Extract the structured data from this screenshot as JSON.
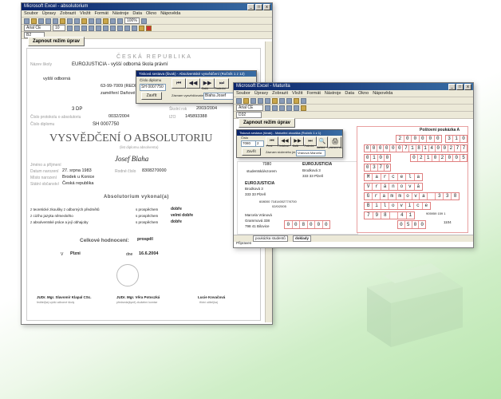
{
  "word": {
    "title": "Microsoft Excel - absolutorium",
    "menu": [
      "Soubor",
      "Úpravy",
      "Zobrazit",
      "Vložit",
      "Formát",
      "Nástroje",
      "Data",
      "Okno",
      "Nápověda"
    ],
    "font_name": "Arial CE",
    "font_size": "10",
    "zoom": "100%",
    "cell_ref": "B2",
    "protect_button": "Zapnout režim úprav"
  },
  "certificate": {
    "country": "ČESKÁ REPUBLIKA",
    "school_label": "Název školy",
    "school_name": "EUROJUSTICIA - vyšší odborná škola právní",
    "school_type": "vyšší odborná",
    "school_addr": "63-99-7009 (REDIZOV)",
    "school_kind": "zaměření  Daňové poradenství",
    "reg_no_label": "Evidenční číslo",
    "reg_no": "3 DP",
    "date_label": "Školní rok",
    "date_val": "2003/2004",
    "izo_label": "IZO",
    "izo": "145893388",
    "copy_label": "Číslo protokolu o absolutoriu",
    "copy_val": "0032/2004",
    "diploma_label": "Číslo diplomu",
    "diploma_no": "SH 0007750",
    "heading": "VYSVĚDČENÍ O ABSOLUTORIU",
    "subheading": "(list diplomu absolventa)",
    "name": "Josef  Blaha",
    "name_label": "Jméno a příjmení",
    "birth_label": "Datum narození",
    "birth": "27. srpna 1983",
    "rc_label": "Rodné číslo",
    "rc": "8308270000",
    "birthplace_label": "Místo narození",
    "birthplace": "Brodek u Konice",
    "citizenship_label": "Státní občanství",
    "citizenship": "Česká republika",
    "exam_title": "Absolutorium vykonal(a)",
    "exam_rows": [
      {
        "subject": "z teoretické zkoušky z odborných předmětů",
        "result": "s prospěchem",
        "grade": "dobře"
      },
      {
        "subject": "z cizího jazyka  německého",
        "result": "s prospěchem",
        "grade": "velmi dobře"
      },
      {
        "subject": "z absolventské práce a její obhajoby",
        "result": "s prospěchem",
        "grade": "dobře"
      }
    ],
    "overall_label": "Celkové hodnocení:",
    "overall": "prospěl",
    "place_label": "V",
    "place": "Plzni",
    "day_label": "dne",
    "day": "16.6.2004",
    "sig1_name": "JUDr. Mgr. Slavomír Klapal CSc.",
    "sig1_role": "ředitel(ka) vyšší odborné školy",
    "sig2_name": "JUDr. Mgr. Věra Potoczká",
    "sig2_role": "předseda(kyně) zkušební komise",
    "sig3_name": "Lucie Kovačová",
    "sig3_role": "třídní učitel(ka)"
  },
  "word_dialog": {
    "title": "Tisková sestava (šivak) - Absolventské vysvědčení (Ročník 1 z 12)",
    "field_label": "Číslo diplomu",
    "field_value": "SH 0007750",
    "print_label": "Záznam vysvědčovatelem",
    "print_value": "Blaha Josef",
    "btn_first": "První",
    "btn_prev": "Předchozí",
    "btn_next": "Další",
    "btn_last": "Poslední",
    "btn_print": "Zavřít"
  },
  "excel": {
    "title": "Microsoft Excel - Maturita",
    "menu": [
      "Soubor",
      "Úpravy",
      "Zobrazit",
      "Vložit",
      "Formát",
      "Nástroje",
      "Data",
      "Okno",
      "Nápověda"
    ],
    "font_name": "Arial CE",
    "cell_ref": "D32",
    "protect_button": "Zapnout režim úprav",
    "dialog_title": "Tisková sestava (šivak) - Maturitní zkouška (Ročník 1 z 1)",
    "dlg_field_label": "Číslo",
    "dlg_field_value": "7080",
    "dlg_field2_value": "2",
    "dlg_btn_close": "Zavřít",
    "dlg_sel_label": "Záznam složeného jm.",
    "dlg_sel_value": "Vránová Marcela",
    "dlg_btns": [
      "První",
      "Předchozí",
      "Další",
      "Poslední"
    ],
    "dlg_btn_print": "Nahled",
    "dlg_btn_print2": "Vytisknout vše",
    "cells": {
      "c1": "7080",
      "c2": "EUROJUSTICIA",
      "c3": "studentská/vzorem",
      "c4": "Brodková 3",
      "c5": "333 33 Plzeň",
      "c6": "EUROJUSTICIA",
      "c7": "Brodková 3",
      "c8": "333 33 Plzeň",
      "c9": "608000 7181400277/0700",
      "c10": "02/0/2005",
      "c11": "Marcela Vránová",
      "c12": "Grammová 338",
      "c13": "798 41 Bilovice"
    },
    "poukaz_title": "Poštovní poukázka A",
    "boxes": {
      "r1": [
        "2",
        "0",
        "0",
        "0",
        "0",
        "0"
      ],
      "r1b": [
        "3",
        "1",
        "0"
      ],
      "r2": [
        "0",
        "0",
        "0",
        "0",
        "0",
        "0",
        "7",
        "1",
        "8",
        "1",
        "4",
        "0",
        "0",
        "2",
        "7",
        "7"
      ],
      "r3": [
        "0",
        "1",
        "0",
        "0"
      ],
      "r3b": [
        "0",
        "2",
        "1",
        "0",
        "2",
        "0",
        "0",
        "5"
      ],
      "r4": [
        "0",
        "3",
        "7",
        "9"
      ],
      "name": [
        "M",
        "a",
        "r",
        "c",
        "e",
        "l",
        "a"
      ],
      "surname": [
        "V",
        "r",
        "á",
        "n",
        "o",
        "v",
        "á"
      ],
      "street": [
        "G",
        "r",
        "a",
        "m",
        "m",
        "o",
        "v",
        "a",
        " ",
        "3",
        "3",
        "8"
      ],
      "city": [
        "B",
        "i",
        "l",
        "o",
        "v",
        "i",
        "c",
        "e"
      ],
      "zip": [
        "7",
        "9",
        "8",
        " ",
        "4",
        "1"
      ],
      "bottom": [
        "0",
        "0",
        "8",
        "0",
        "0",
        "0"
      ],
      "bottom2": [
        "0",
        "5",
        "0",
        "0"
      ]
    },
    "side_code": "905959  159 1",
    "side_num": "1104",
    "sheet_tabs": [
      "poukázka studentů",
      "doklady"
    ],
    "status": "Připraven"
  },
  "colors": {
    "accent": "#0a246a",
    "poukaz_red": "#e08080",
    "gradient_green": "#b8e6ad"
  }
}
